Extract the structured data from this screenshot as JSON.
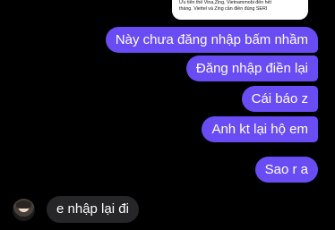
{
  "quoted_card": {
    "line1": "Ưu tiên thẻ Vina,Zing, Vietnammobi đến hết",
    "line2": "tháng. Viettel và Zing cần điền đúng SERI"
  },
  "messages_out": [
    "Này chưa đăng nhập bấm nhầm",
    "Đăng nhập điền lại",
    "Cái báo z",
    "Anh kt lại hộ em",
    "Sao r a"
  ],
  "message_in": "e nhập lại đi",
  "colors": {
    "outgoing_bubble": "#6a4cf5",
    "incoming_bubble": "#262629",
    "background": "#000000"
  }
}
